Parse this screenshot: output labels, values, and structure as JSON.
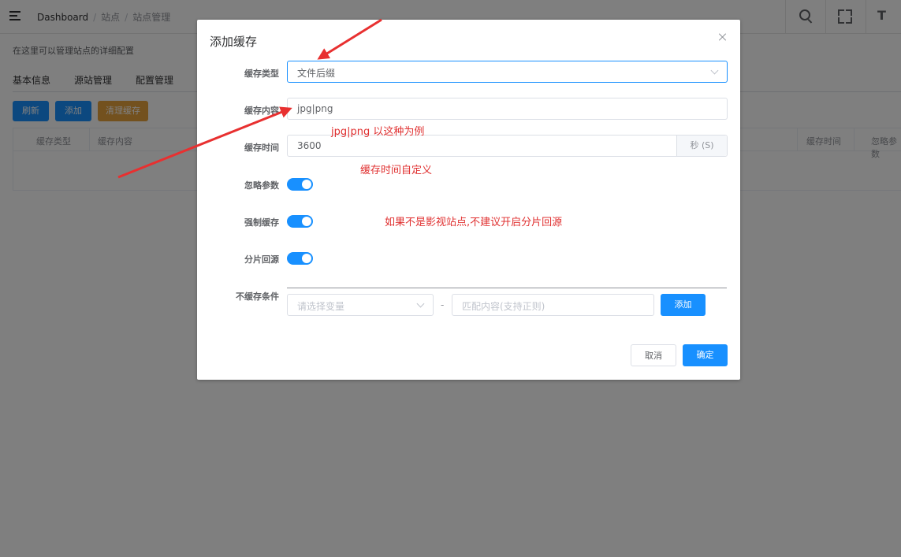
{
  "header": {
    "breadcrumb": [
      "Dashboard",
      "站点",
      "站点管理"
    ]
  },
  "page": {
    "description": "在这里可以管理站点的详细配置",
    "tabs": [
      "基本信息",
      "源站管理",
      "配置管理"
    ],
    "buttons": {
      "refresh": "刷新",
      "add": "添加",
      "clear_cache": "清理缓存"
    },
    "table_headers": [
      "缓存类型",
      "缓存内容",
      "缓存时间",
      "忽略参数"
    ]
  },
  "dialog": {
    "title": "添加缓存",
    "fields": {
      "cache_type": {
        "label": "缓存类型",
        "value": "文件后缀"
      },
      "cache_content": {
        "label": "缓存内容",
        "value": "jpg|png"
      },
      "cache_time": {
        "label": "缓存时间",
        "value": "3600",
        "unit": "秒 (S)"
      },
      "ignore_params": {
        "label": "忽略参数",
        "on": true
      },
      "force_cache": {
        "label": "强制缓存",
        "on": true
      },
      "slice_origin": {
        "label": "分片回源",
        "on": true
      },
      "no_cache_condition": {
        "label": "不缓存条件",
        "variable_placeholder": "请选择变量",
        "separator": "-",
        "match_placeholder": "匹配内容(支持正则)",
        "add_label": "添加"
      }
    },
    "footer": {
      "cancel": "取消",
      "confirm": "确定"
    }
  },
  "annotations": {
    "content_example": "jpg|png   以这种为例",
    "time_custom": "缓存时间自定义",
    "slice_hint": "如果不是影视站点,不建议开启分片回源"
  },
  "colors": {
    "primary": "#1890ff",
    "warning": "#e6a23c",
    "annotation": "#e03030"
  }
}
